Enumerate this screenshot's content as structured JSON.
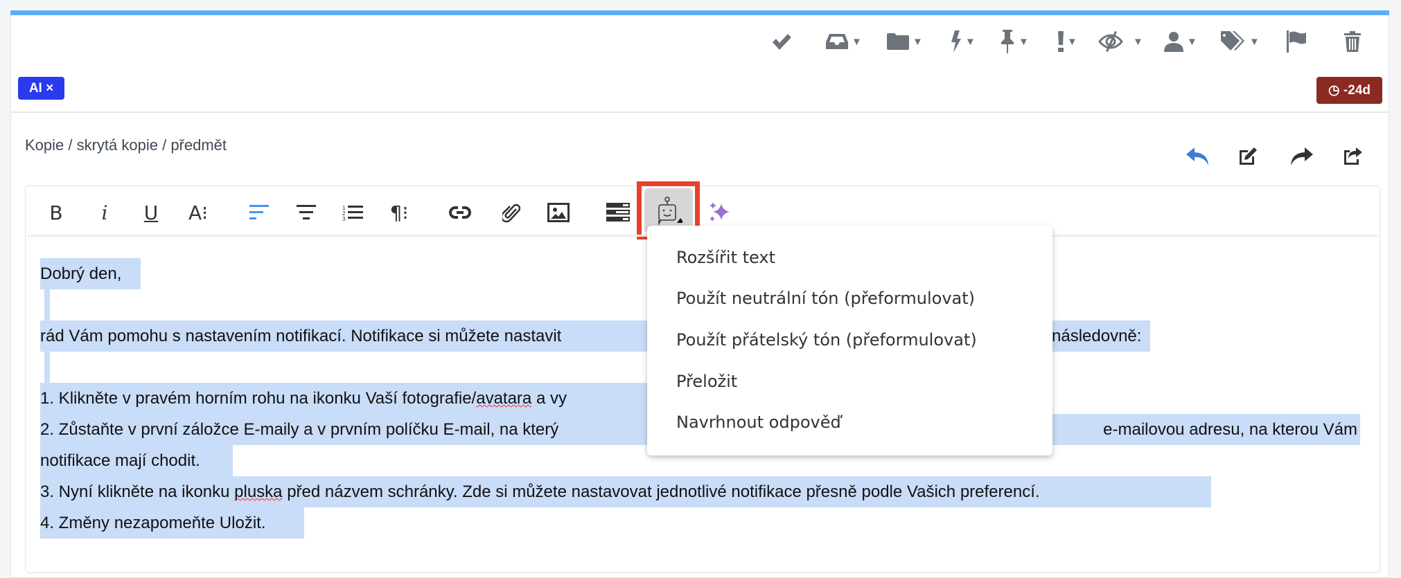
{
  "toolbar": {
    "icons": [
      "check-icon",
      "inbox-icon",
      "folder-icon",
      "bolt-icon",
      "pin-icon",
      "exclamation-icon",
      "eye-slash-icon",
      "user-icon",
      "tags-icon",
      "flag-icon",
      "trash-icon"
    ]
  },
  "badges": {
    "ai": "AI ×",
    "ai_color": "#2a3bef",
    "due": "◷ -24d",
    "due_color": "#8b2a22"
  },
  "compose": {
    "fields_link": "Kopie / skrytá kopie / předmět"
  },
  "editor": {
    "toolbar": {
      "bold": "B",
      "italic": "i",
      "underline": "U",
      "font": "A⁝",
      "paragraph": "¶⁝"
    },
    "lines": {
      "l1": "Dobrý den,",
      "l3a": "rád Vám pomohu s nastavením notifikací. Notifikace si můžete nastavit",
      "l3b": "následovně:",
      "l5a": "1. Klikněte v pravém horním rohu na ikonku Vaší fotografie/",
      "l5b": "avatara",
      "l5c": " a vy",
      "l6a": "2. Zůstaňte v první záložce E-maily a v prvním políčku E-mail, na který",
      "l6b": "e-mailovou adresu, na kterou Vám",
      "l7": "notifikace mají chodit.",
      "l8a": "3. Nyní klikněte na ikonku ",
      "l8b": "pluska",
      "l8c": " před názvem schránky. Zde si můžete nastavovat jednotlivé notifikace přesně podle Vašich preferencí.",
      "l9": "4. Změny nezapomeňte Uložit."
    },
    "highlight_color": "#c9dcf8"
  },
  "ai_menu": {
    "items": [
      "Rozšířit text",
      "Použít neutrální tón (přeformulovat)",
      "Použít přátelský tón (přeformulovat)",
      "Přeložit",
      "Navrhnout odpověď"
    ]
  }
}
